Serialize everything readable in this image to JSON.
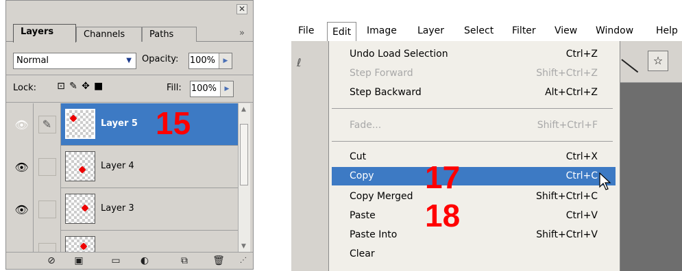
{
  "layers_panel": {
    "tabs": [
      "Layers",
      "Channels",
      "Paths"
    ],
    "active_tab": "Layers",
    "tab_menu_icon": "double-chevron-right-icon",
    "blend_mode": "Normal",
    "opacity_label": "Opacity:",
    "opacity_value": "100%",
    "lock_label": "Lock:",
    "lock_icons": [
      "transparency-lock-icon",
      "brush-lock-icon",
      "move-lock-icon",
      "padlock-icon"
    ],
    "fill_label": "Fill:",
    "fill_value": "100%",
    "layers": [
      {
        "name": "Layer 5",
        "selected": true,
        "visible": true,
        "annotation": "15"
      },
      {
        "name": "Layer 4",
        "selected": false,
        "visible": true
      },
      {
        "name": "Layer 3",
        "selected": false,
        "visible": true
      },
      {
        "name": "",
        "selected": false,
        "visible": true
      }
    ],
    "bottom_icons": [
      "link-icon",
      "layer-style-icon",
      "mask-icon",
      "folder-icon",
      "adjustment-icon",
      "new-layer-icon",
      "trash-icon"
    ]
  },
  "app": {
    "menubar": [
      "File",
      "Edit",
      "Image",
      "Layer",
      "Select",
      "Filter",
      "View",
      "Window",
      "Help"
    ],
    "active_menu": "Edit",
    "edit_menu": [
      {
        "label": "Undo Load Selection",
        "shortcut": "Ctrl+Z",
        "disabled": false
      },
      {
        "label": "Step Forward",
        "shortcut": "Shift+Ctrl+Z",
        "disabled": true
      },
      {
        "label": "Step Backward",
        "shortcut": "Alt+Ctrl+Z",
        "disabled": false
      },
      {
        "label": "Fade...",
        "shortcut": "Shift+Ctrl+F",
        "disabled": true
      },
      {
        "label": "Cut",
        "shortcut": "Ctrl+X",
        "disabled": false
      },
      {
        "label": "Copy",
        "shortcut": "Ctrl+C",
        "disabled": false,
        "highlighted": true
      },
      {
        "label": "Copy Merged",
        "shortcut": "Shift+Ctrl+C",
        "disabled": false
      },
      {
        "label": "Paste",
        "shortcut": "Ctrl+V",
        "disabled": false
      },
      {
        "label": "Paste Into",
        "shortcut": "Shift+Ctrl+V",
        "disabled": false
      },
      {
        "label": "Clear",
        "shortcut": "",
        "disabled": false
      }
    ],
    "annotations": {
      "copy": "17",
      "paste": "18"
    }
  },
  "colors": {
    "selection": "#3d7ac4",
    "panel": "#d6d3ce",
    "annotation": "#ff0000"
  }
}
